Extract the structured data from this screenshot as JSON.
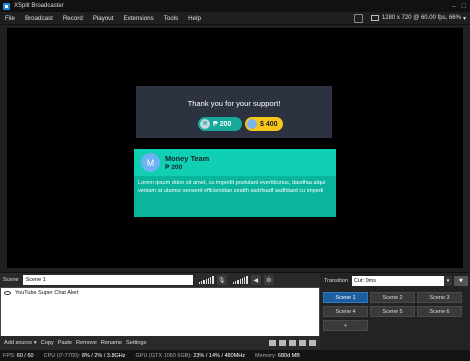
{
  "window": {
    "title": "XSplit Broadcaster"
  },
  "menu": [
    "File",
    "Broadcast",
    "Record",
    "Playout",
    "Extensions",
    "Tools",
    "Help"
  ],
  "resolution": "1280 x 720 @ 60.00 fps, 66%",
  "stage": {
    "thanks": {
      "title": "Thank you for your support!",
      "points_icon": "W",
      "points": "₱ 200",
      "money": "$ 400"
    },
    "alert": {
      "avatar": "M",
      "name": "Money Team",
      "amount": "₱ 200",
      "message": "Lorem ipsum dolor sit amet, cu impedit postulant everttiturius, dasdfaa atqui veniam at utamur senserit efficiendian zeatth asdrfsadf asdfdasd cu impedi"
    }
  },
  "scene_bar": {
    "label": "Scene",
    "name": "Scene 1"
  },
  "sources": [
    {
      "label": "YouTube Super Chat Alert"
    }
  ],
  "source_toolbar": [
    "Add source ▾",
    "Copy",
    "Paste",
    "Remove",
    "Rename",
    "Settings"
  ],
  "transition": {
    "label": "Transition",
    "value": "Cut: 0ms"
  },
  "scenes": [
    {
      "label": "Scene 1",
      "active": true
    },
    {
      "label": "Scene 2",
      "active": false
    },
    {
      "label": "Scene 3",
      "active": false
    },
    {
      "label": "Scene 4",
      "active": false
    },
    {
      "label": "Scene 5",
      "active": false
    },
    {
      "label": "Scene 6",
      "active": false
    },
    {
      "label": "+",
      "active": false
    }
  ],
  "status": {
    "fps": "FPS:",
    "fps_val": "60 / 60",
    "cpu": "CPU (i7-7700):",
    "cpu_val": "8% / 2% / 3.8GHz",
    "gpu": "GPU (GTX 1060 6GB):",
    "gpu_val": "23% / 14% / 480MHz",
    "mem": "Memory:",
    "mem_val": "680d MB"
  },
  "colors": {
    "accent": "#1d5f9e",
    "alert_bg": "#09b59c",
    "card_bg": "#2c3240",
    "money_pill": "#f5c51b"
  }
}
